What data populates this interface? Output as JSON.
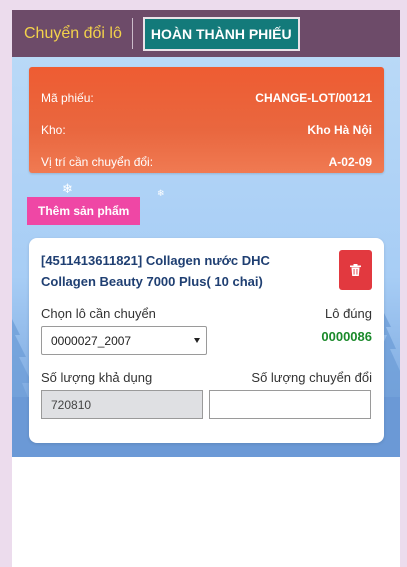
{
  "header": {
    "title": "Chuyển đổi lô",
    "complete_button": "HOÀN THÀNH PHIẾU"
  },
  "info": {
    "ticket_label": "Mã phiếu:",
    "ticket_value": "CHANGE-LOT/00121",
    "warehouse_label": "Kho:",
    "warehouse_value": "Kho Hà Nội",
    "location_label": "Vị trí cần chuyển đổi:",
    "location_value": "A-02-09"
  },
  "add_product_button": "Thêm sản phẩm",
  "product": {
    "name": "[4511413611821] Collagen nước DHC Collagen Beauty 7000 Plus( 10 chai)",
    "choose_lot_label": "Chọn lô cần chuyển",
    "choose_lot_value": "0000027_2007",
    "correct_lot_label": "Lô đúng",
    "correct_lot_value": "0000086",
    "available_qty_label": "Số lượng khả dụng",
    "available_qty_value": "720810",
    "convert_qty_label": "Số lượng chuyển đổi",
    "convert_qty_value": ""
  },
  "colors": {
    "topbar": "#6d4b69",
    "title": "#f3d24b",
    "complete_button": "#137a7a",
    "info_card": "#ee5c32",
    "add_button": "#ef47a5",
    "delete_button": "#e2393f",
    "product_name": "#1f3f72",
    "correct_lot": "#1b8a2b"
  },
  "icons": {
    "delete": "trash-icon",
    "select": "caret-down-icon",
    "decor": "snowflake-icon"
  }
}
